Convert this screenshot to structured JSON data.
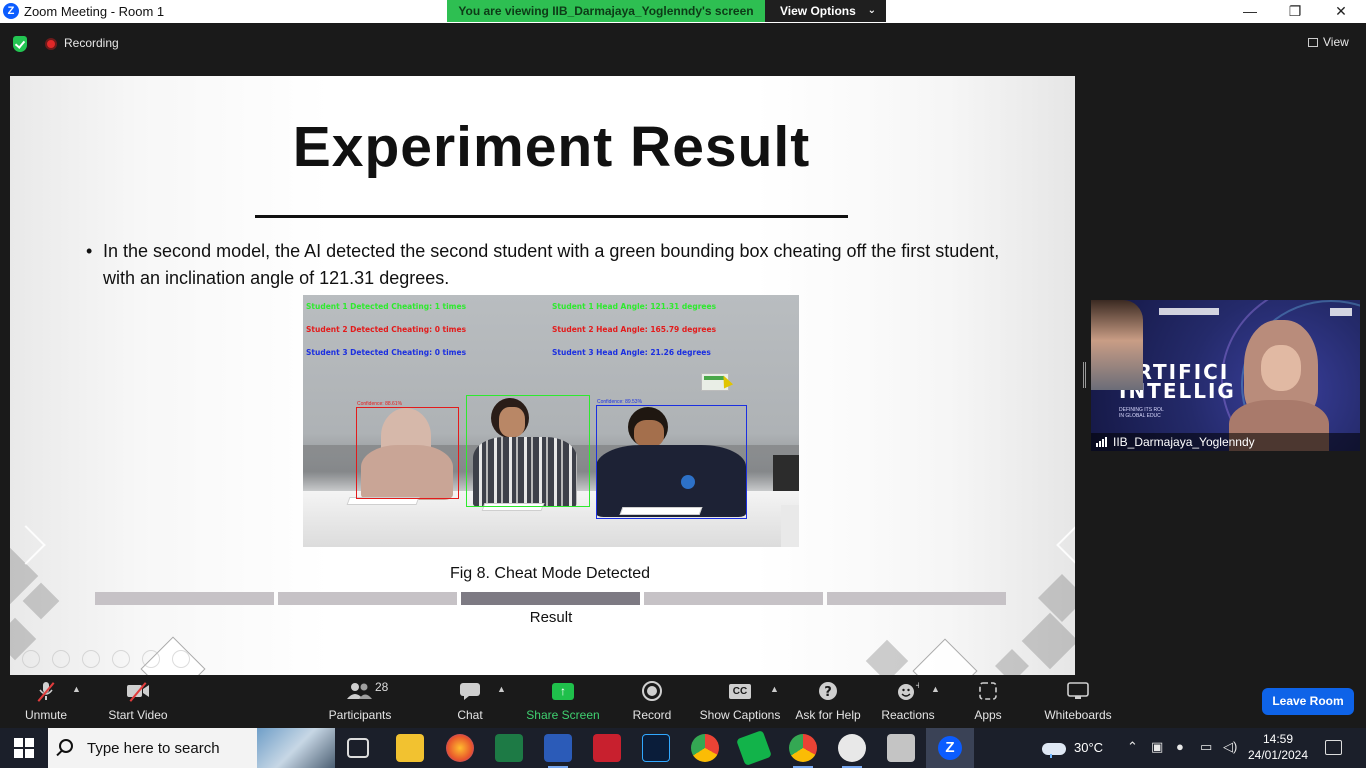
{
  "window": {
    "title": "Zoom Meeting - Room 1",
    "banner_text": "You are viewing IIB_Darmajaya_Yoglenndy's screen",
    "view_options_label": "View Options",
    "controls": [
      "—",
      "❐",
      "✕"
    ]
  },
  "meeting_bar": {
    "recording_label": "Recording",
    "view_label": "View"
  },
  "slide": {
    "title": "Experiment Result",
    "bullet": "In the second model, the AI detected the second student with a green bounding box cheating off the first student, with an inclination angle of 121.31 degrees.",
    "figure": {
      "overlay_left": [
        "Student 1 Detected Cheating: 1 times",
        "Student 2 Detected Cheating: 0 times",
        "Student 3 Detected Cheating: 0 times"
      ],
      "overlay_right": [
        "Student 1 Head Angle: 121.31 degrees",
        "Student 2 Head Angle: 165.79 degrees",
        "Student 3 Head Angle: 21.26 degrees"
      ],
      "box_labels": [
        "Confidence: 88.61%",
        "Confidence: 89.53%"
      ]
    },
    "caption": "Fig 8. Cheat Mode Detected",
    "progress": {
      "segments": 5,
      "active_index": 2
    },
    "progress_label": "Result"
  },
  "participant_tile": {
    "name": "IIB_Darmajaya_Yoglenndy",
    "banner_text": "ARTIFICI\nINTELLIG",
    "banner_subtext": "DEFINING ITS ROL\nIN GLOBAL EDUC"
  },
  "toolbar": {
    "unmute": "Unmute",
    "start_video": "Start Video",
    "participants": "Participants",
    "participants_count": "28",
    "chat": "Chat",
    "share_screen": "Share Screen",
    "record": "Record",
    "show_captions": "Show Captions",
    "ask_for_help": "Ask for Help",
    "reactions": "Reactions",
    "apps": "Apps",
    "whiteboards": "Whiteboards",
    "leave_room": "Leave Room",
    "cc_label": "CC"
  },
  "taskbar": {
    "search_placeholder": "Type here to search",
    "temperature": "30°C",
    "time": "14:59",
    "date": "24/01/2024",
    "apps": [
      "task-view",
      "file-explorer",
      "firefox",
      "excel",
      "word",
      "presentation-app",
      "photoshop",
      "chrome",
      "green-app",
      "chrome-profile",
      "whatsapp",
      "folder-app",
      "zoom"
    ]
  },
  "colors": {
    "zoom_blue": "#0b5cff",
    "banner_green": "#2ebf52",
    "leave_blue": "#0e63e8",
    "record_red": "#e02828"
  }
}
